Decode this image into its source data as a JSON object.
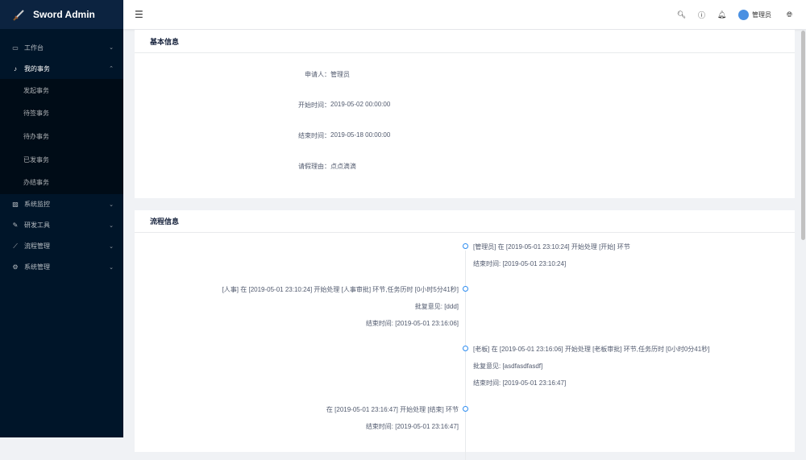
{
  "app": {
    "title": "Sword Admin"
  },
  "sidebar": {
    "items": [
      {
        "label": "工作台",
        "icon": "monitor-icon",
        "expanded": false
      },
      {
        "label": "我的事务",
        "icon": "bell-icon",
        "expanded": true,
        "children": [
          "发起事务",
          "待签事务",
          "待办事务",
          "已发事务",
          "办结事务"
        ]
      },
      {
        "label": "系统监控",
        "icon": "chart-icon",
        "expanded": false
      },
      {
        "label": "研发工具",
        "icon": "tool-icon",
        "expanded": false
      },
      {
        "label": "流程管理",
        "icon": "flow-icon",
        "expanded": false
      },
      {
        "label": "系统管理",
        "icon": "gear-icon",
        "expanded": false
      }
    ]
  },
  "header": {
    "user": "管理员"
  },
  "basic": {
    "title": "基本信息",
    "fields": [
      {
        "label": "申请人：",
        "value": "管理员"
      },
      {
        "label": "开始时间：",
        "value": "2019-05-02 00:00:00"
      },
      {
        "label": "结束时间：",
        "value": "2019-05-18 00:00:00"
      },
      {
        "label": "请假理由：",
        "value": "点点滴滴"
      }
    ]
  },
  "flow": {
    "title": "流程信息",
    "items": [
      {
        "side": "right",
        "lines": [
          "[管理员] 在 [2019-05-01 23:10:24] 开始处理 [开始] 环节",
          "结束时间: [2019-05-01 23:10:24]"
        ]
      },
      {
        "side": "left",
        "lines": [
          "[人事] 在 [2019-05-01 23:10:24] 开始处理 [人事审批] 环节,任务历时 [0小时5分41秒]",
          "批复意见: [ddd]",
          "结束时间: [2019-05-01 23:16:06]"
        ]
      },
      {
        "side": "right",
        "lines": [
          "[老板] 在 [2019-05-01 23:16:06] 开始处理 [老板审批] 环节,任务历时 [0小时0分41秒]",
          "批复意见: [asdfasdfasdf]",
          "结束时间: [2019-05-01 23:16:47]"
        ]
      },
      {
        "side": "left",
        "lines": [
          "在 [2019-05-01 23:16:47] 开始处理 [结束] 环节",
          "结束时间: [2019-05-01 23:16:47]"
        ]
      }
    ]
  },
  "colors": {
    "sidebar": "#001529",
    "accent": "#2d8cf0"
  }
}
